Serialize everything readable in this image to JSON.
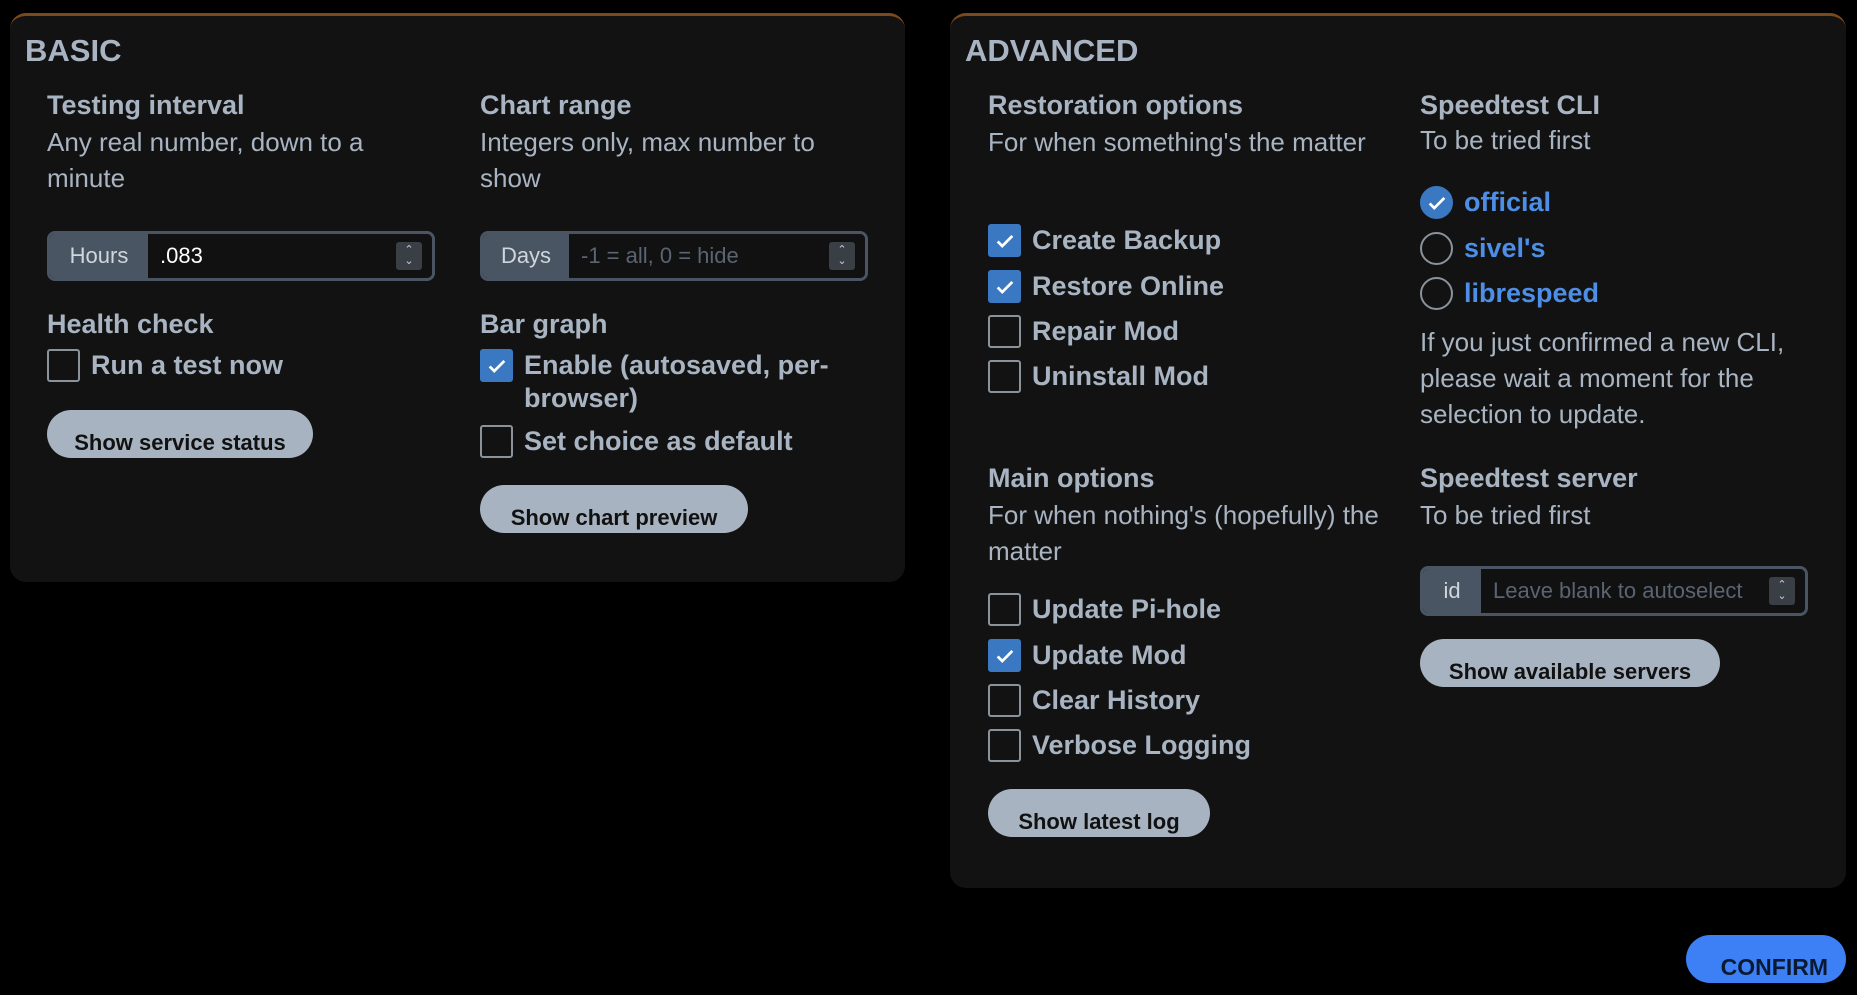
{
  "basic": {
    "title": "BASIC",
    "testing_interval": {
      "title": "Testing interval",
      "desc": "Any real number, down to a minute",
      "addon": "Hours",
      "value": ".083"
    },
    "chart_range": {
      "title": "Chart range",
      "desc": "Integers only, max number to show",
      "addon": "Days",
      "placeholder": "-1 = all, 0 = hide"
    },
    "health_check": {
      "title": "Health check",
      "run_test_label": "Run a test now",
      "run_test_checked": false,
      "button": "Show service status"
    },
    "bar_graph": {
      "title": "Bar graph",
      "enable_label": "Enable (autosaved, per-browser)",
      "enable_checked": true,
      "default_label": "Set choice as default",
      "default_checked": false,
      "button": "Show chart preview"
    }
  },
  "advanced": {
    "title": "ADVANCED",
    "restoration": {
      "title": "Restoration options",
      "desc": "For when something's the matter",
      "options": [
        {
          "label": "Create Backup",
          "checked": true
        },
        {
          "label": "Restore Online",
          "checked": true
        },
        {
          "label": "Repair Mod",
          "checked": false
        },
        {
          "label": "Uninstall Mod",
          "checked": false
        }
      ]
    },
    "speedtest_cli": {
      "title": "Speedtest CLI",
      "desc": "To be tried first",
      "options": [
        {
          "label": "official",
          "checked": true
        },
        {
          "label": "sivel's",
          "checked": false
        },
        {
          "label": "librespeed",
          "checked": false
        }
      ],
      "note": "If you just confirmed a new CLI, please wait a moment for the selection to update."
    },
    "main_options": {
      "title": "Main options",
      "desc": "For when nothing's (hopefully) the matter",
      "options": [
        {
          "label": "Update Pi-hole",
          "checked": false
        },
        {
          "label": "Update Mod",
          "checked": true
        },
        {
          "label": "Clear History",
          "checked": false
        },
        {
          "label": "Verbose Logging",
          "checked": false
        }
      ],
      "button": "Show latest log"
    },
    "speedtest_server": {
      "title": "Speedtest server",
      "desc": "To be tried first",
      "addon": "id",
      "placeholder": "Leave blank to autoselect",
      "button": "Show available servers"
    }
  },
  "confirm_label": "CONFIRM",
  "colors": {
    "accent": "#3a78c2",
    "link": "#4d8fe6",
    "panel": "#121212",
    "panel_border": "#7a4a1c",
    "confirm": "#3d7ff5"
  }
}
